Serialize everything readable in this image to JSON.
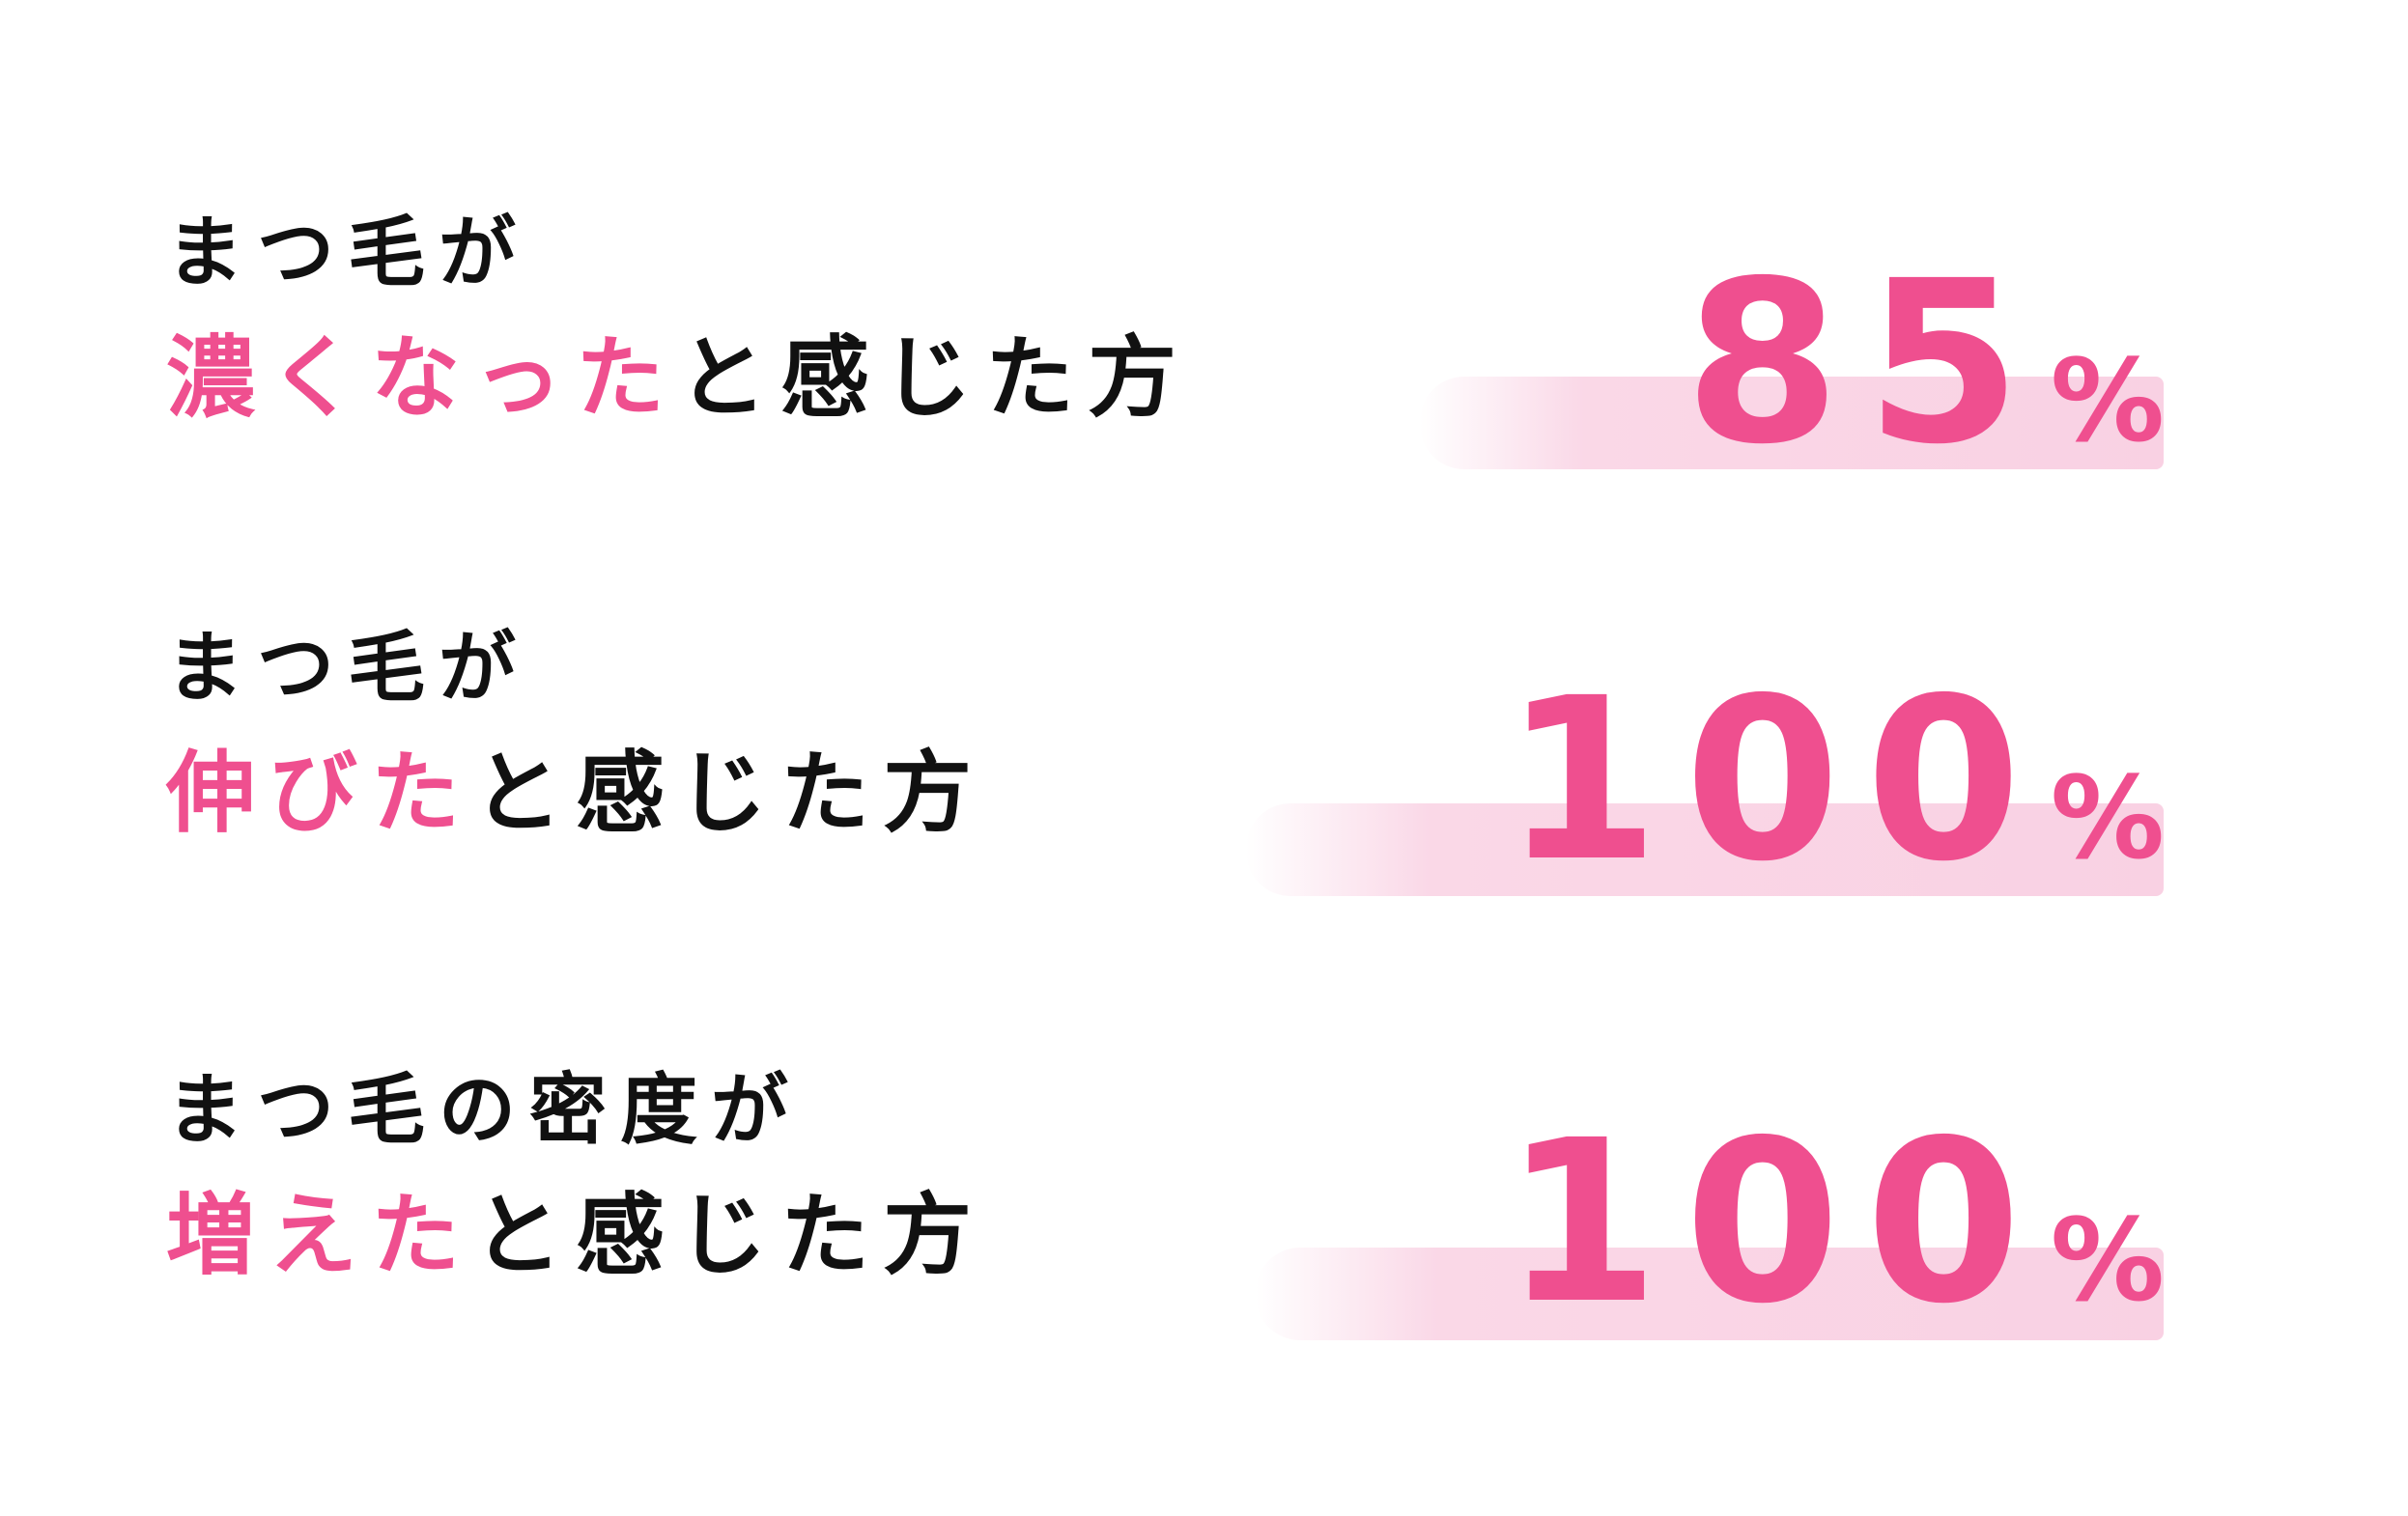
{
  "colors": {
    "accent": "#ef4f8f",
    "text": "#111111",
    "brush": "#f9d1e3"
  },
  "stats": [
    {
      "line1": "まつ毛が",
      "highlight": "濃くなった",
      "suffix": "と感じた方",
      "value": "85",
      "unit": "%"
    },
    {
      "line1": "まつ毛が",
      "highlight": "伸びた",
      "suffix": "と感じた方",
      "value": "100",
      "unit": "%"
    },
    {
      "line1": "まつ毛の密度が",
      "highlight": "増えた",
      "suffix": "と感じた方",
      "value": "100",
      "unit": "%"
    }
  ]
}
